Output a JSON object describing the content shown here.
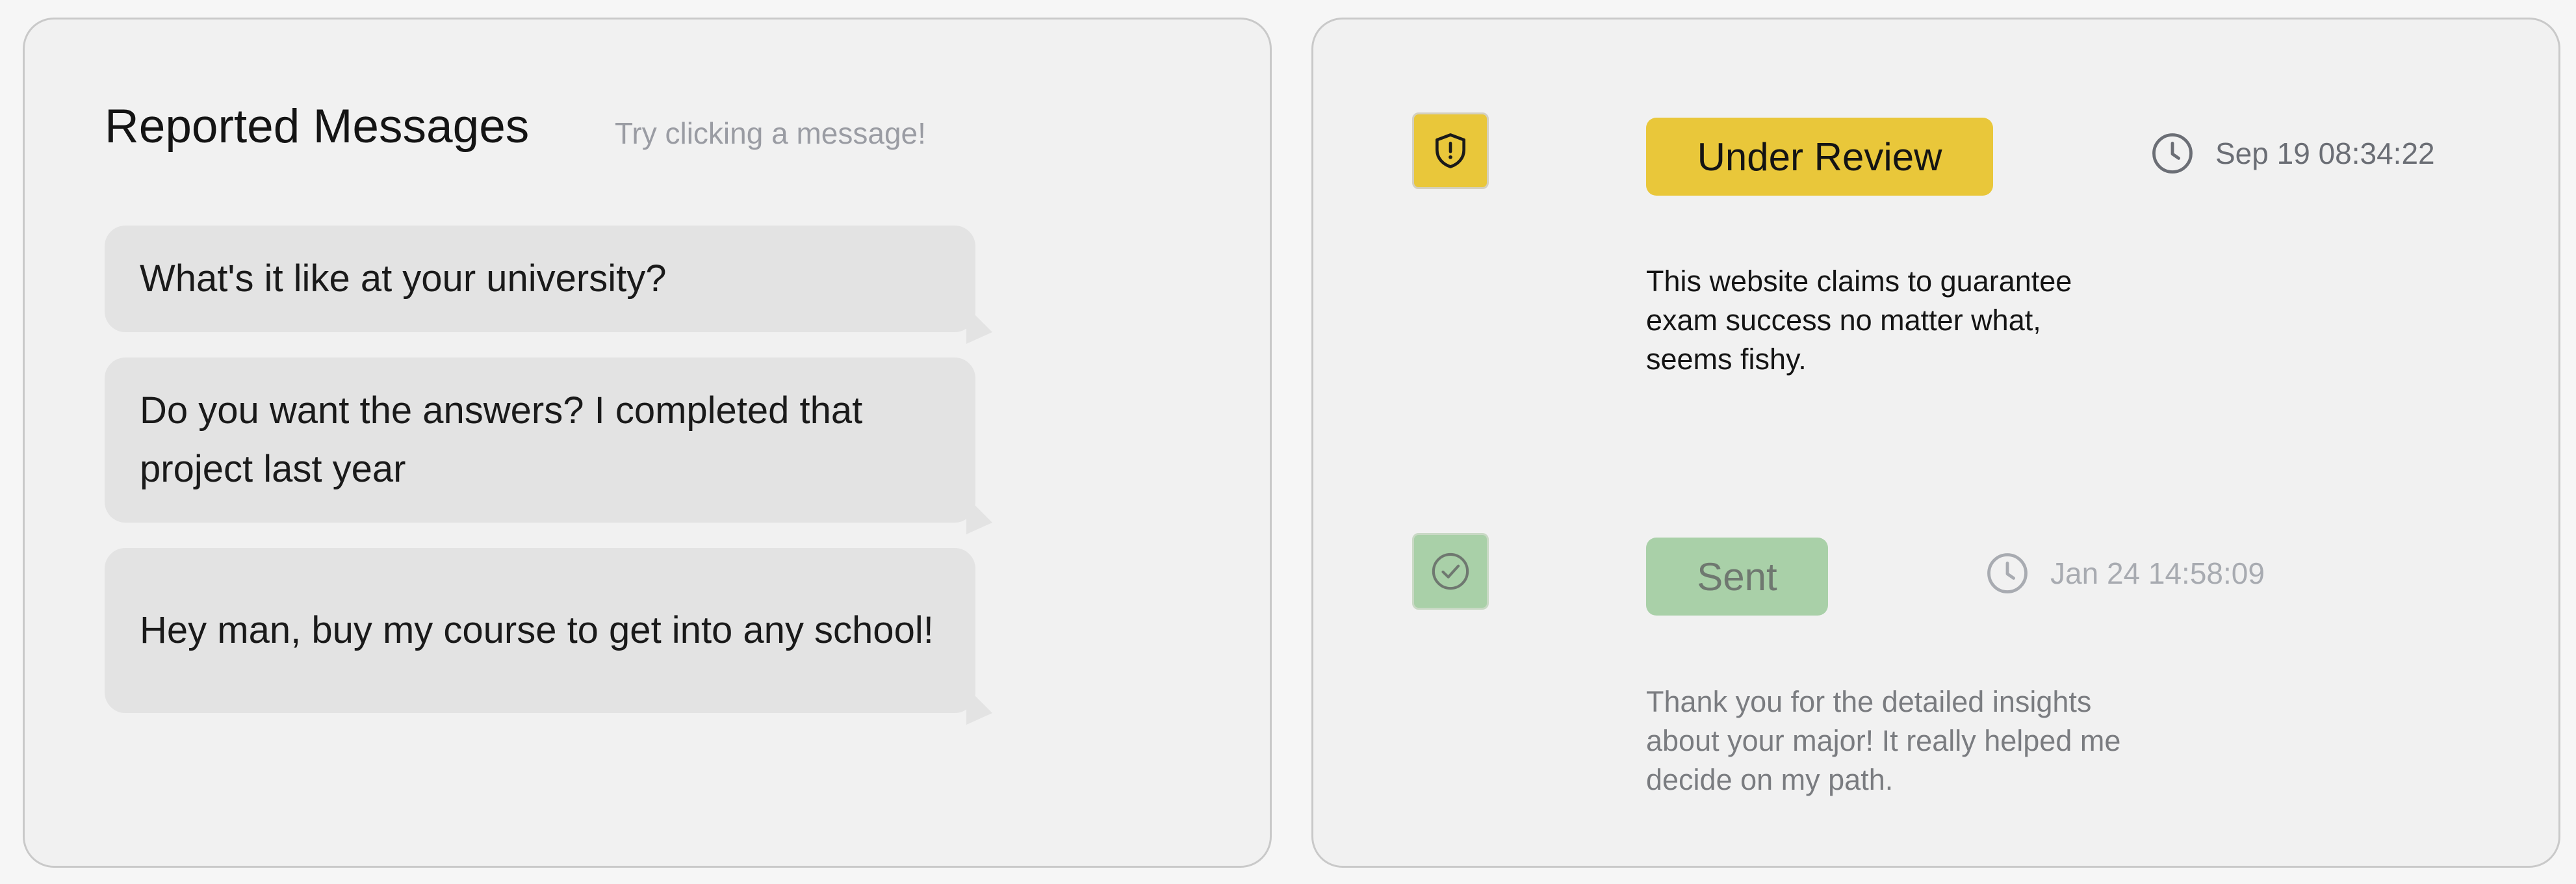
{
  "reported_messages": {
    "title": "Reported Messages",
    "hint": "Try clicking a message!",
    "messages": [
      {
        "text": "What's it like at your university?"
      },
      {
        "text": "Do you want the answers? I completed that project last year"
      },
      {
        "text": "Hey man, buy my course to get into any school!"
      }
    ]
  },
  "reports": [
    {
      "status": "Under Review",
      "status_icon": "shield-alert-icon",
      "status_color": "#e9c73a",
      "timestamp": "Sep 19 08:34:22",
      "note": "This website claims to guarantee exam success no matter what, seems fishy."
    },
    {
      "status": "Sent",
      "status_icon": "check-circle-icon",
      "status_color": "#a9d0a8",
      "timestamp": "Jan 24 14:58:09",
      "note": "Thank you for the detailed insights about your major! It really helped me decide on my path."
    }
  ]
}
